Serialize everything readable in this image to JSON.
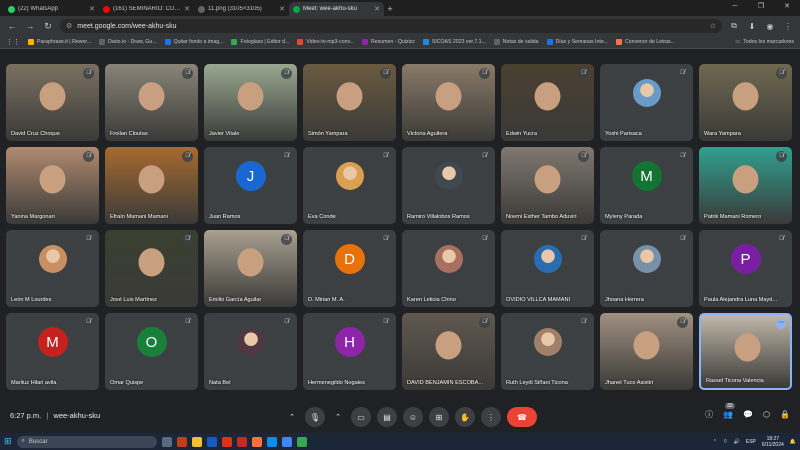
{
  "browser": {
    "tabs": [
      {
        "label": "(22) WhatsApp",
        "icon": "whatsapp-icon",
        "color": "#25d366"
      },
      {
        "label": "(161) SEMINARIO: CULTURA DI",
        "icon": "youtube-icon",
        "color": "#ff0000"
      },
      {
        "label": "11.png (3105×3105)",
        "icon": "image-icon",
        "color": "#5f6368"
      },
      {
        "label": "Meet: wee-akhu-sku",
        "icon": "meet-icon",
        "color": "#00ac47",
        "active": true
      }
    ],
    "new_tab": "+",
    "url": "meet.google.com/wee-akhu-sku",
    "bookmarks": [
      {
        "label": "Paraphrase.it | Rewor...",
        "color": "#ffb300"
      },
      {
        "label": "Dario.io - Draw, Gu...",
        "color": "#5f6368"
      },
      {
        "label": "Quitar fondo a imag...",
        "color": "#1a73e8"
      },
      {
        "label": "Fotoglass | Editor d...",
        "color": "#34a853"
      },
      {
        "label": "Video-to-mp3-conv...",
        "color": "#ea4335"
      },
      {
        "label": "Resumen - Quizizz",
        "color": "#8e24aa"
      },
      {
        "label": "SICOAS 2023 ver.7.1...",
        "color": "#1e88e5"
      },
      {
        "label": "Notas de salida",
        "color": "#5f6368"
      },
      {
        "label": "Días y Semanas Inte...",
        "color": "#1a73e8"
      },
      {
        "label": "Convenor de Letras...",
        "color": "#ff7043"
      }
    ],
    "bookmarks_all": "Todos los marcadores"
  },
  "participants": [
    {
      "name": "David Cruz Choque",
      "type": "video",
      "color": "#7a7060"
    },
    {
      "name": "Froilan Cloutas",
      "type": "video",
      "color": "#8a8478"
    },
    {
      "name": "Javier Vitale",
      "type": "video",
      "color": "#9aa890"
    },
    {
      "name": "Simón Yampara",
      "type": "video",
      "color": "#6a5a40"
    },
    {
      "name": "Victoria Aguilera",
      "type": "video",
      "color": "#8a7a68"
    },
    {
      "name": "Edwin Yucra",
      "type": "video",
      "color": "#4a4030"
    },
    {
      "name": "Yoshi Parisaca",
      "type": "photo",
      "color": "#6a9ac8"
    },
    {
      "name": "Wara Yampara",
      "type": "video",
      "color": "#706850"
    },
    {
      "name": "Yanina Margonari",
      "type": "video",
      "color": "#b08a70"
    },
    {
      "name": "Efraín Mamani Mamani",
      "type": "video",
      "color": "#a86a30"
    },
    {
      "name": "Juan Ramos",
      "type": "letter",
      "letter": "J",
      "color": "#1967d2"
    },
    {
      "name": "Eva Conde",
      "type": "photo",
      "color": "#d8a050"
    },
    {
      "name": "Ramiro Villalobos Ramos",
      "type": "photo",
      "color": "#404850"
    },
    {
      "name": "Noemi Esther Tambo Aduviri",
      "type": "video",
      "color": "#807870"
    },
    {
      "name": "Myleny Parada",
      "type": "letter",
      "letter": "M",
      "color": "#137333"
    },
    {
      "name": "Patrik Mamani Romero",
      "type": "video",
      "color": "#30a090"
    },
    {
      "name": "León M Lourdes",
      "type": "photo",
      "color": "#c89060"
    },
    {
      "name": "José Luis Martínez",
      "type": "video",
      "color": "#3a4030"
    },
    {
      "name": "Emilio García Aguilar",
      "type": "video",
      "color": "#a8a090"
    },
    {
      "name": "D. Mirian M. A.",
      "type": "letter",
      "letter": "D",
      "color": "#e8710a"
    },
    {
      "name": "Karen Leticia Chino",
      "type": "photo",
      "color": "#a87060"
    },
    {
      "name": "OVIDIO VILLCA MAMANI",
      "type": "photo",
      "color": "#2a6cb0"
    },
    {
      "name": "Jhoana Herrera",
      "type": "photo",
      "color": "#7890a8"
    },
    {
      "name": "Paula Alejandra Luna Mayd...",
      "type": "letter",
      "letter": "P",
      "color": "#7b1fa2"
    },
    {
      "name": "Mariluz Hilari avila",
      "type": "letter",
      "letter": "M",
      "color": "#c5221f"
    },
    {
      "name": "Omar Quispe",
      "type": "letter",
      "letter": "O",
      "color": "#188038"
    },
    {
      "name": "Nata Bel",
      "type": "photo",
      "color": "#503840"
    },
    {
      "name": "Hermenegildo Nogales",
      "type": "letter",
      "letter": "H",
      "color": "#8e24aa"
    },
    {
      "name": "DAVID BENJAMIN ESCOBA...",
      "type": "video",
      "color": "#605850"
    },
    {
      "name": "Ruth Leydi Siñani Ticona",
      "type": "photo",
      "color": "#a08068"
    },
    {
      "name": "Jhanet Tuco Asistiri",
      "type": "video",
      "color": "#a09080"
    },
    {
      "name": "Rassel Ticona Valencia",
      "type": "video",
      "color": "#c0b8a8",
      "self": true
    }
  ],
  "meeting": {
    "time": "6:27 p.m.",
    "separator": "|",
    "code": "wee-akhu-sku",
    "people_count": "32"
  },
  "taskbar": {
    "search_placeholder": "Buscar",
    "lang": "ESP",
    "time": "18:27",
    "date": "6/11/2024"
  }
}
